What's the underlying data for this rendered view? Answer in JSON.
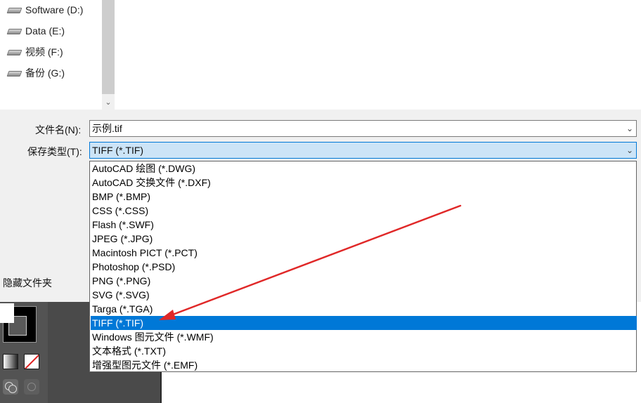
{
  "nav": {
    "drives": [
      {
        "label": "Software (D:)",
        "icon": "drive-icon"
      },
      {
        "label": "Data (E:)",
        "icon": "drive-icon"
      },
      {
        "label": "视频 (F:)",
        "icon": "drive-icon"
      },
      {
        "label": "备份 (G:)",
        "icon": "drive-icon"
      }
    ]
  },
  "form": {
    "filename_label": "文件名(N):",
    "filename_value": "示例.tif",
    "type_label": "保存类型(T):",
    "type_value": "TIFF (*.TIF)",
    "hide_folders": "隐藏文件夹"
  },
  "dropdown": {
    "options": [
      "AutoCAD 绘图 (*.DWG)",
      "AutoCAD 交换文件 (*.DXF)",
      "BMP (*.BMP)",
      "CSS (*.CSS)",
      "Flash (*.SWF)",
      "JPEG (*.JPG)",
      "Macintosh PICT (*.PCT)",
      "Photoshop (*.PSD)",
      "PNG (*.PNG)",
      "SVG (*.SVG)",
      "Targa (*.TGA)",
      "TIFF (*.TIF)",
      "Windows 图元文件 (*.WMF)",
      "文本格式 (*.TXT)",
      "增强型图元文件 (*.EMF)"
    ],
    "selected_index": 11
  },
  "colors": {
    "selection": "#0078d7",
    "arrow": "#e02828"
  }
}
